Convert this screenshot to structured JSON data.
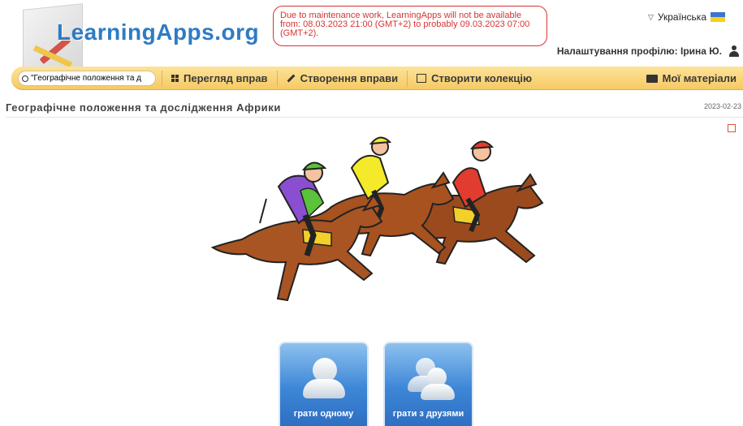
{
  "header": {
    "logo_text": "LearningApps.org",
    "maintenance_notice": "Due to maintenance work, LearningApps will not be available from: 08.03.2023 21:00 (GMT+2) to probably 09.03.2023 07:00 (GMT+2).",
    "language": "Українська",
    "profile_label": "Налаштування профілю: Ірина Ю."
  },
  "nav": {
    "search_value": "\"Географічне положення та д",
    "items": [
      {
        "label": "Перегляд вправ",
        "icon": "grid-icon"
      },
      {
        "label": "Створення вправи",
        "icon": "pencil-icon"
      },
      {
        "label": "Створити колекцію",
        "icon": "collection-icon"
      }
    ],
    "my_materials": "Мої матеріали"
  },
  "page": {
    "title": "Географічне положення та дослідження Африки",
    "date": "2023-02-23"
  },
  "play": {
    "single": "грати одному",
    "friends": "грати з друзями"
  },
  "colors": {
    "accent": "#2e7bc4",
    "navbar": "#f6c960",
    "alert": "#d9322f"
  }
}
